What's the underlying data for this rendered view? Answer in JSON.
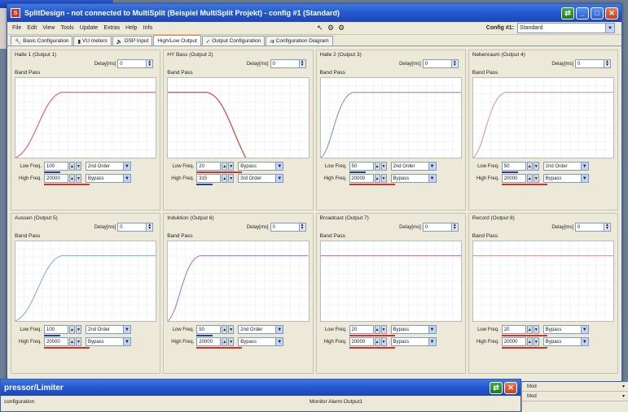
{
  "app": {
    "title": "SplitDesign - not connected to MultiSplit (Beispiel MultiSplit Projekt) - config #1 (Standard)",
    "icon_label": "S"
  },
  "menu": [
    "File",
    "Edit",
    "View",
    "Tools",
    "Update",
    "Extras",
    "Help",
    "Info"
  ],
  "config": {
    "label": "Config #1:",
    "value": "Standard"
  },
  "tabs": [
    {
      "label": "Basic Configuration",
      "icon": "wrench-icon",
      "active": false
    },
    {
      "label": "VU meters",
      "icon": "meter-icon",
      "active": false
    },
    {
      "label": "DSP Input",
      "icon": "speaker-icon",
      "active": false
    },
    {
      "label": "High/Low Output",
      "icon": "",
      "active": true
    },
    {
      "label": "Output Configuration",
      "icon": "",
      "active": false
    },
    {
      "label": "Configuration Diagram",
      "icon": "diagram-icon",
      "active": false
    }
  ],
  "labels": {
    "delay": "Delay[ms]",
    "band_pass": "Band Pass",
    "low_freq": "Low Freq.",
    "high_freq": "High Freq."
  },
  "outputs": [
    {
      "name": "Halle 1 (Output 1)",
      "delay": "0",
      "low": "100",
      "low_order": "2nd Order",
      "high": "20000",
      "high_order": "Bypass",
      "color": "#e07070",
      "curve": "lowcut"
    },
    {
      "name": "HY Bass (Output 2)",
      "delay": "0",
      "low": "20",
      "low_order": "Bypass",
      "high": "315",
      "high_order": "3rd Order",
      "color": "#d05050",
      "curve": "highcut"
    },
    {
      "name": "Halle 2 (Output 3)",
      "delay": "0",
      "low": "50",
      "low_order": "2nd Order",
      "high": "20000",
      "high_order": "Bypass",
      "color": "#8aa5c8",
      "curve": "lowcut"
    },
    {
      "name": "Nebenraum (Output 4)",
      "delay": "0",
      "low": "50",
      "low_order": "2nd Order",
      "high": "20000",
      "high_order": "Bypass",
      "color": "#d9a9a9",
      "curve": "lowcut"
    },
    {
      "name": "Aussen (Output 5)",
      "delay": "0",
      "low": "100",
      "low_order": "2nd Order",
      "high": "20000",
      "high_order": "Bypass",
      "color": "#8fbcd6",
      "curve": "lowcut"
    },
    {
      "name": "Induktion (Output 6)",
      "delay": "0",
      "low": "50",
      "low_order": "2nd Order",
      "high": "20000",
      "high_order": "Bypass",
      "color": "#b389c9",
      "curve": "lowcut"
    },
    {
      "name": "Broadcast (Output 7)",
      "delay": "0",
      "low": "20",
      "low_order": "Bypass",
      "high": "20000",
      "high_order": "Bypass",
      "color": "#c982b8",
      "curve": "flat"
    },
    {
      "name": "Record (Output 8)",
      "delay": "0",
      "low": "20",
      "low_order": "Bypass",
      "high": "20000",
      "high_order": "Bypass",
      "color": "#e0a0a0",
      "curve": "flat"
    }
  ],
  "window2": {
    "title": "pressor/Limiter",
    "left_label": "configuration",
    "right_label": "Monitor Alarm Output1"
  },
  "side_strip": [
    "Mod",
    "Mod"
  ]
}
